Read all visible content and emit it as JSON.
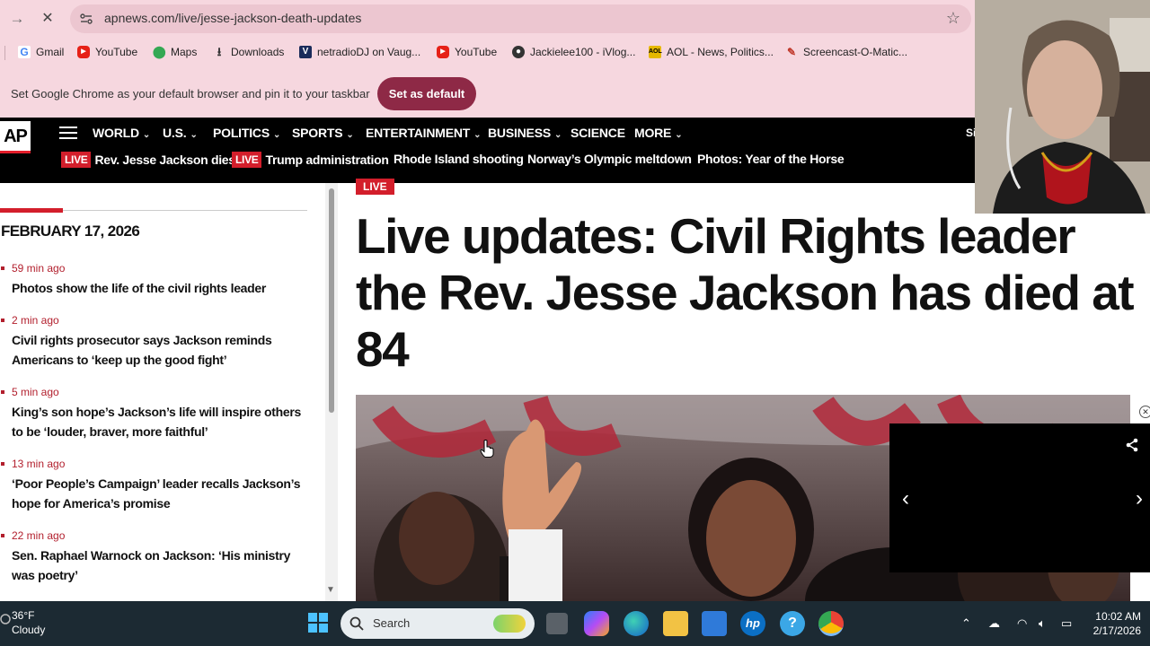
{
  "browser": {
    "url": "apnews.com/live/jesse-jackson-death-updates",
    "bookmarks": [
      {
        "label": "Gmail",
        "icon": "gmail-icon",
        "color": "#4285f4"
      },
      {
        "label": "YouTube",
        "icon": "youtube-icon",
        "color": "#ff0000"
      },
      {
        "label": "Maps",
        "icon": "maps-icon",
        "color": "#34a853"
      },
      {
        "label": "Downloads",
        "icon": "download-icon",
        "color": "#333333"
      },
      {
        "label": "netradioDJ on Vaug...",
        "icon": "vaughn-icon",
        "color": "#1a2b5a"
      },
      {
        "label": "YouTube",
        "icon": "youtube-icon",
        "color": "#ff0000"
      },
      {
        "label": "Jackielee100 - iVlog...",
        "icon": "ivlog-icon",
        "color": "#333333"
      },
      {
        "label": "AOL - News, Politics...",
        "icon": "aol-icon",
        "color": "#e6b800"
      },
      {
        "label": "Screencast-O-Matic...",
        "icon": "screencast-icon",
        "color": "#c0392b"
      }
    ],
    "infobar": {
      "message": "Set Google Chrome as your default browser and pin it to your taskbar",
      "button": "Set as default"
    }
  },
  "ap": {
    "logo": "AP",
    "nav": [
      "WORLD",
      "U.S.",
      "POLITICS",
      "SPORTS",
      "ENTERTAINMENT",
      "BUSINESS",
      "SCIENCE",
      "MORE"
    ],
    "nav_has_dropdown": [
      true,
      true,
      true,
      true,
      true,
      true,
      false,
      true
    ],
    "signin_partial": "Si",
    "live_label": "LIVE",
    "subnav": [
      {
        "label": "Rev. Jesse Jackson dies",
        "live": true
      },
      {
        "label": "Trump administration",
        "live": true
      },
      {
        "label": "Rhode Island shooting",
        "live": false
      },
      {
        "label": "Norway’s Olympic meltdown",
        "live": false
      },
      {
        "label": "Photos: Year of the Horse",
        "live": false
      }
    ]
  },
  "sidebar": {
    "date": "FEBRUARY 17, 2026",
    "updates": [
      {
        "time": "59 min ago",
        "title": "Photos show the life of the civil rights leader"
      },
      {
        "time": "2 min ago",
        "title": "Civil rights prosecutor says Jackson reminds Americans to ‘keep up the good fight’"
      },
      {
        "time": "5 min ago",
        "title": "King’s son hope’s Jackson’s life will inspire others to be ‘louder, braver, more faithful’"
      },
      {
        "time": "13 min ago",
        "title": "‘Poor People’s Campaign’ leader recalls Jackson’s hope for America’s promise"
      },
      {
        "time": "22 min ago",
        "title": "Sen. Raphael Warnock on Jackson: ‘His ministry was poetry’"
      }
    ]
  },
  "article": {
    "live_tag": "LIVE",
    "headline": "Live updates: Civil Rights leader the Rev. Jesse Jackson has died at 84"
  },
  "taskbar": {
    "temperature": "36°F",
    "condition": "Cloudy",
    "search_placeholder": "Search",
    "time": "10:02 AM",
    "date": "2/17/2026"
  }
}
